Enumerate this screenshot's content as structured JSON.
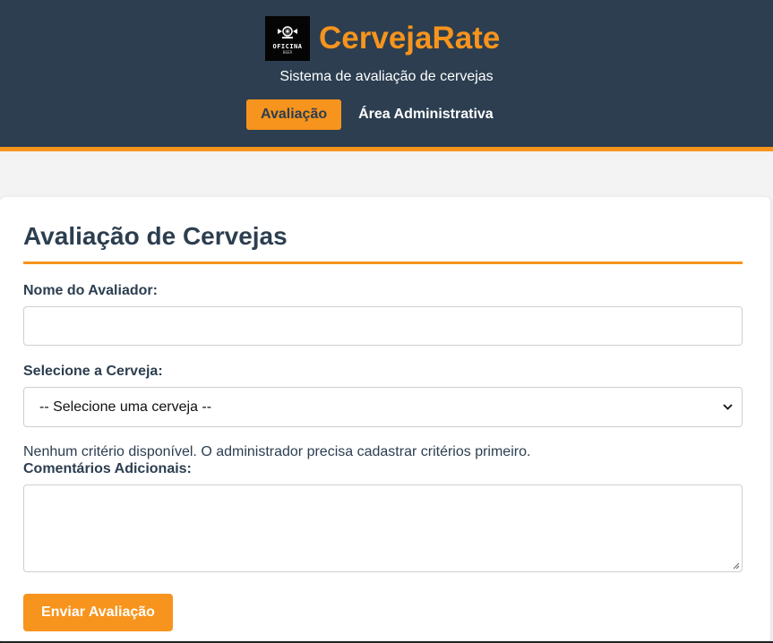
{
  "header": {
    "app_title": "CervejaRate",
    "subtitle": "Sistema de avaliação de cervejas",
    "logo": {
      "text": "OFICINA",
      "subtext": "BEER"
    },
    "nav": [
      {
        "label": "Avaliação",
        "active": true
      },
      {
        "label": "Área Administrativa",
        "active": false
      }
    ]
  },
  "form": {
    "title": "Avaliação de Cervejas",
    "evaluator_label": "Nome do Avaliador:",
    "evaluator_value": "",
    "beer_label": "Selecione a Cerveja:",
    "beer_selected": "-- Selecione uma cerveja --",
    "no_criteria_message": "Nenhum critério disponível. O administrador precisa cadastrar critérios primeiro.",
    "comments_label": "Comentários Adicionais:",
    "comments_value": "",
    "submit_label": "Enviar Avaliação"
  },
  "colors": {
    "header_bg": "#2c3e50",
    "accent": "#f7941d",
    "page_bg": "#f3f3f3",
    "card_bg": "#ffffff"
  },
  "icons": {
    "logo": "beer-brand-logo",
    "select_chevron": "chevron-down-icon",
    "resize_handle": "resize-grip-icon"
  }
}
